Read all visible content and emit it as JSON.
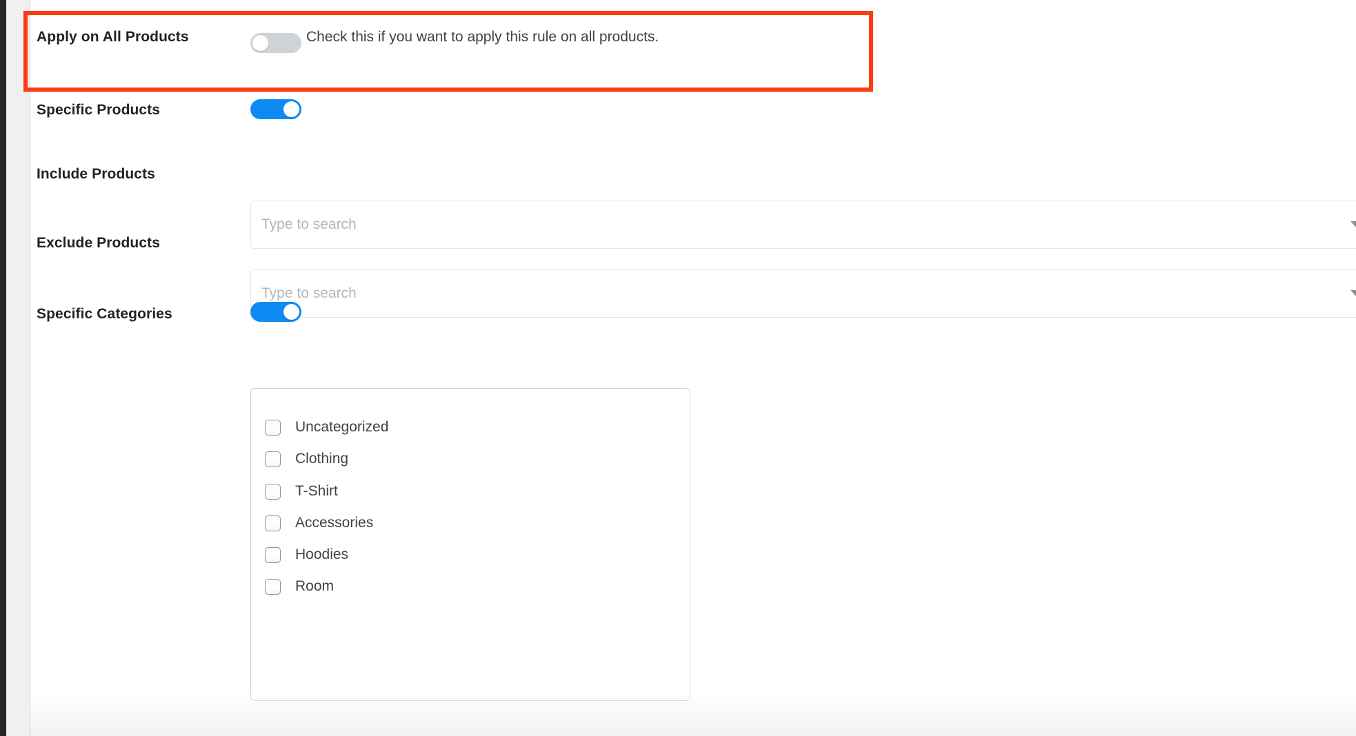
{
  "theme": {
    "accent_blue": "#0d8bf2",
    "toggle_off_gray": "#ced3d8",
    "label_color": "#1d2327",
    "text_color": "#3c434a",
    "placeholder_color": "#b3b5b7",
    "annotation_red": "#fa3c10",
    "admin_rail_dark": "#23282d",
    "admin_gutter_gray": "#f0f0f1"
  },
  "form": {
    "apply_all_products": {
      "label": "Apply on All Products",
      "toggle_state": "off",
      "helper_text": "Check this if you want to apply this rule on all products.",
      "annotated": true
    },
    "specific_products": {
      "label": "Specific Products",
      "toggle_state": "on"
    },
    "include_products": {
      "label": "Include Products",
      "placeholder": "Type to search",
      "value": "",
      "caret_icon": "chevron-down-icon"
    },
    "exclude_products": {
      "label": "Exclude Products",
      "placeholder": "Type to search",
      "value": "",
      "caret_icon": "chevron-down-icon"
    },
    "specific_categories": {
      "label": "Specific Categories",
      "toggle_state": "on",
      "categories": [
        {
          "label": "Uncategorized",
          "checked": false
        },
        {
          "label": "Clothing",
          "checked": false
        },
        {
          "label": "T-Shirt",
          "checked": false
        },
        {
          "label": "Accessories",
          "checked": false
        },
        {
          "label": "Hoodies",
          "checked": false
        },
        {
          "label": "Room",
          "checked": false
        }
      ]
    }
  }
}
